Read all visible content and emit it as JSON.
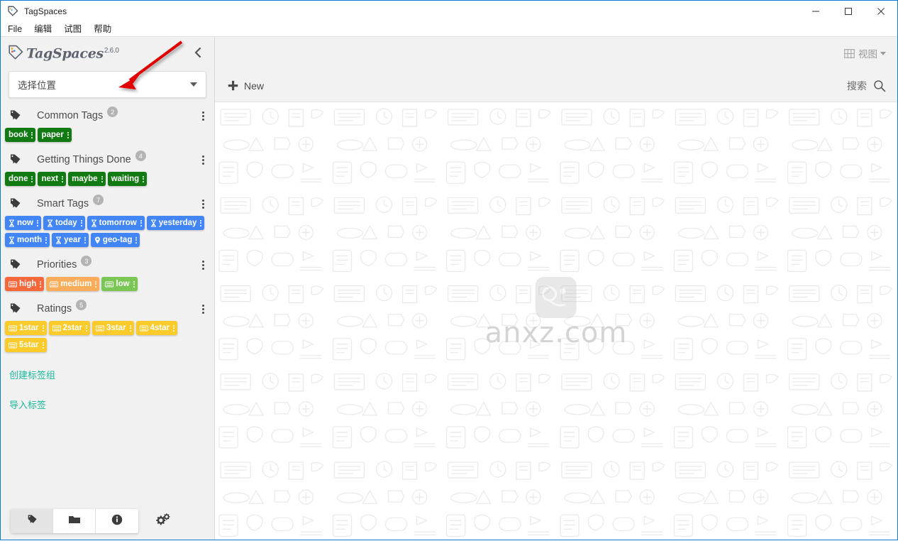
{
  "window": {
    "title": "TagSpaces",
    "app_icon": "tag-icon",
    "controls": {
      "minimize": "minimize-icon",
      "maximize": "maximize-icon",
      "close": "close-icon"
    }
  },
  "menubar": {
    "items": [
      {
        "label": "File"
      },
      {
        "label": "编辑"
      },
      {
        "label": "试图"
      },
      {
        "label": "帮助"
      }
    ]
  },
  "sidebar": {
    "brand": {
      "name": "TagSpaces",
      "version": "2.6.0"
    },
    "collapse_icon": "chevron-left-icon",
    "location_select": {
      "value": "选择位置",
      "caret": "chevron-down-icon"
    },
    "tag_groups": [
      {
        "title": "Common Tags",
        "count": "2",
        "color": "#127a12",
        "tags": [
          {
            "label": "book",
            "icon": ""
          },
          {
            "label": "paper",
            "icon": ""
          }
        ]
      },
      {
        "title": "Getting Things Done",
        "count": "4",
        "color": "#127a12",
        "tags": [
          {
            "label": "done",
            "icon": ""
          },
          {
            "label": "next",
            "icon": ""
          },
          {
            "label": "maybe",
            "icon": ""
          },
          {
            "label": "waiting",
            "icon": ""
          }
        ]
      },
      {
        "title": "Smart Tags",
        "count": "7",
        "color": "#4285f4",
        "tags": [
          {
            "label": "now",
            "icon": "hourglass-icon"
          },
          {
            "label": "today",
            "icon": "hourglass-icon"
          },
          {
            "label": "tomorrow",
            "icon": "hourglass-icon"
          },
          {
            "label": "yesterday",
            "icon": "hourglass-icon"
          },
          {
            "label": "month",
            "icon": "hourglass-icon"
          },
          {
            "label": "year",
            "icon": "hourglass-icon"
          },
          {
            "label": "geo-tag",
            "icon": "location-pin-icon"
          }
        ]
      },
      {
        "title": "Priorities",
        "count": "3",
        "color": "",
        "tags": [
          {
            "label": "high",
            "icon": "keyboard-icon",
            "color": "#f4683c"
          },
          {
            "label": "medium",
            "icon": "keyboard-icon",
            "color": "#f9ad5a"
          },
          {
            "label": "low",
            "icon": "keyboard-icon",
            "color": "#7ac756"
          }
        ]
      },
      {
        "title": "Ratings",
        "count": "5",
        "color": "#fbcb2c",
        "tags": [
          {
            "label": "1star",
            "icon": "keyboard-icon"
          },
          {
            "label": "2star",
            "icon": "keyboard-icon"
          },
          {
            "label": "3star",
            "icon": "keyboard-icon"
          },
          {
            "label": "4star",
            "icon": "keyboard-icon"
          },
          {
            "label": "5star",
            "icon": "keyboard-icon"
          }
        ]
      }
    ],
    "links": [
      {
        "label": "创建标签组"
      },
      {
        "label": "导入标签"
      }
    ],
    "bottom_buttons": [
      {
        "name": "tag-library-button",
        "icon": "tag-icon",
        "active": true
      },
      {
        "name": "file-manager-button",
        "icon": "folder-icon",
        "active": false
      },
      {
        "name": "info-button",
        "icon": "info-icon",
        "active": false
      }
    ],
    "settings_button": {
      "icon": "gears-icon"
    }
  },
  "main": {
    "view_button": {
      "label": "视图",
      "icon": "grid-view-icon",
      "caret": "chevron-down-icon"
    },
    "new_button": {
      "label": "New",
      "icon": "plus-icon"
    },
    "search_button": {
      "label": "搜索",
      "icon": "search-icon"
    },
    "watermark": {
      "text": "anxz.com",
      "logo": "anxz-logo"
    }
  },
  "annotation": {
    "arrow_color": "#e00000"
  },
  "colors": {
    "accent_link": "#1bb99a",
    "titlebar_border": "#0a7bd0",
    "sidebar_bg": "#f1f1f1",
    "toolbar_bg": "#f2f2f2",
    "badge_gray": "#b4b4b4"
  }
}
